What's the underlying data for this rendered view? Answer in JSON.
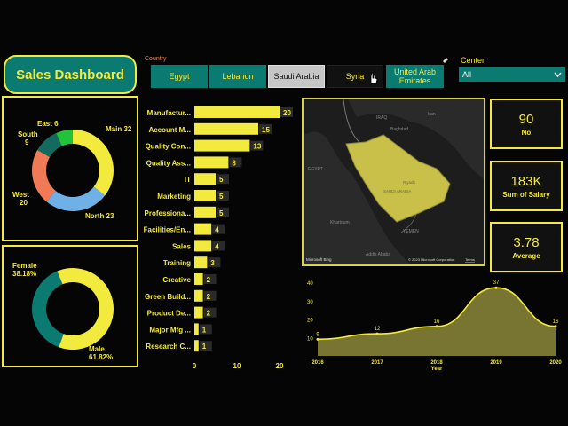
{
  "header": {
    "title": "Sales Dashboard"
  },
  "country_filter": {
    "label": "Country",
    "options": [
      "Egypt",
      "Lebanon",
      "Saudi Arabia",
      "Syria",
      "United Arab Emirates"
    ],
    "selected": "Saudi Arabia"
  },
  "center_filter": {
    "label": "Center",
    "value": "All"
  },
  "kpis": [
    {
      "value": "90",
      "label": "No"
    },
    {
      "value": "183K",
      "label": "Sum of Salary"
    },
    {
      "value": "3.78",
      "label": "Average"
    }
  ],
  "map": {
    "copyright": "© 2023 Microsoft Corporation",
    "terms": "Terms",
    "brand": "Microsoft Bing",
    "places": [
      "Baghdad",
      "EGYPT",
      "SAUDI ARABIA",
      "Riyadh",
      "YEMEN",
      "Khartoum",
      "Addis Ababa",
      "Iran",
      "IRAQ"
    ]
  },
  "colors": {
    "yellow": "#f2ea3d",
    "teal": "#0b7a70",
    "blue": "#6fb0e6",
    "orange": "#f07a55",
    "green": "#22c23a",
    "gray": "#6b6b6b",
    "dark_teal": "#136b5f"
  },
  "chart_data": [
    {
      "type": "pie",
      "variant": "donut",
      "categories": [
        "Main",
        "North",
        "West",
        "South",
        "East"
      ],
      "values": [
        32,
        23,
        20,
        9,
        6
      ],
      "labels": [
        "Main 32",
        "North 23",
        "West 20",
        "South 9",
        "East 6"
      ],
      "colors": [
        "#f2ea3d",
        "#6fb0e6",
        "#f07a55",
        "#136b5f",
        "#22c23a"
      ]
    },
    {
      "type": "pie",
      "variant": "donut",
      "categories": [
        "Female",
        "Male"
      ],
      "values": [
        38.18,
        61.82
      ],
      "labels": [
        [
          "Female",
          "38.18%"
        ],
        [
          "Male",
          "61.82%"
        ]
      ],
      "colors": [
        "#0b7a70",
        "#f2ea3d"
      ]
    },
    {
      "type": "bar",
      "orientation": "horizontal",
      "categories": [
        "Manufactur...",
        "Account M...",
        "Quality Con...",
        "Quality Ass...",
        "IT",
        "Marketing",
        "Professiona...",
        "Facilities/En...",
        "Sales",
        "Training",
        "Creative",
        "Green Build...",
        "Product De...",
        "Major Mfg ...",
        "Research C..."
      ],
      "values": [
        20,
        15,
        13,
        8,
        5,
        5,
        5,
        4,
        4,
        3,
        2,
        2,
        2,
        1,
        1
      ],
      "xlim": [
        0,
        20
      ],
      "xticks": [
        0,
        10,
        20
      ],
      "color": "#f2ea3d"
    },
    {
      "type": "area",
      "x": [
        2016,
        2017,
        2018,
        2019,
        2020
      ],
      "y": [
        9,
        12,
        16,
        37,
        16
      ],
      "xlabel": "Year",
      "ylim": [
        0,
        40
      ],
      "yticks": [
        10,
        20,
        30,
        40
      ],
      "color": "#f2ea3d"
    }
  ]
}
